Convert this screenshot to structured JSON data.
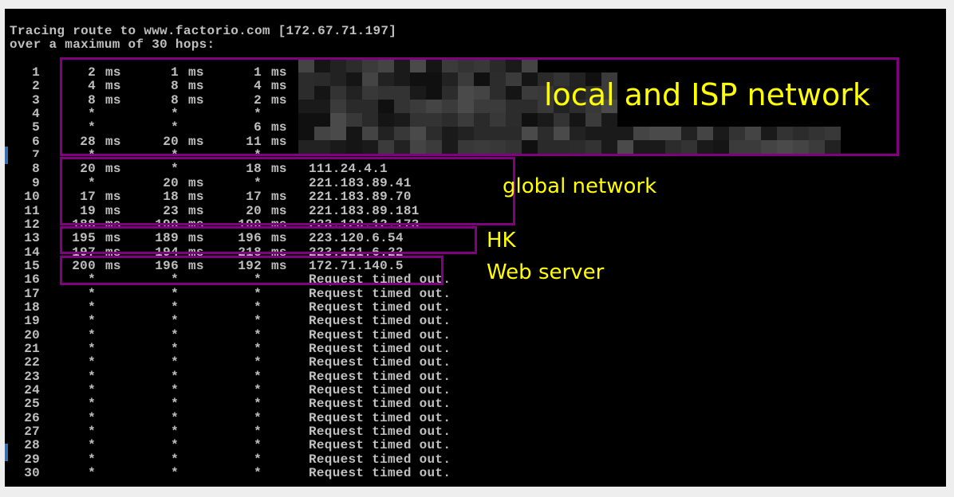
{
  "terminal": {
    "header_line_1": "Tracing route to www.factorio.com [172.67.71.197]",
    "header_line_2": "over a maximum of 30 hops:",
    "rows": [
      {
        "hop": "1",
        "r1": "2",
        "u1": "ms",
        "r2": "1",
        "u2": "ms",
        "r3": "1",
        "u3": "ms",
        "host": ""
      },
      {
        "hop": "2",
        "r1": "4",
        "u1": "ms",
        "r2": "8",
        "u2": "ms",
        "r3": "4",
        "u3": "ms",
        "host": ""
      },
      {
        "hop": "3",
        "r1": "8",
        "u1": "ms",
        "r2": "8",
        "u2": "ms",
        "r3": "2",
        "u3": "ms",
        "host": ""
      },
      {
        "hop": "4",
        "r1": "*",
        "u1": "",
        "r2": "*",
        "u2": "",
        "r3": "*",
        "u3": "",
        "host": ""
      },
      {
        "hop": "5",
        "r1": "*",
        "u1": "",
        "r2": "*",
        "u2": "",
        "r3": "6",
        "u3": "ms",
        "host": ""
      },
      {
        "hop": "6",
        "r1": "28",
        "u1": "ms",
        "r2": "20",
        "u2": "ms",
        "r3": "11",
        "u3": "ms",
        "host": ""
      },
      {
        "hop": "7",
        "r1": "*",
        "u1": "",
        "r2": "*",
        "u2": "",
        "r3": "*",
        "u3": "",
        "host": ""
      },
      {
        "hop": "8",
        "r1": "20",
        "u1": "ms",
        "r2": "*",
        "u2": "",
        "r3": "18",
        "u3": "ms",
        "host": "111.24.4.1"
      },
      {
        "hop": "9",
        "r1": "*",
        "u1": "",
        "r2": "20",
        "u2": "ms",
        "r3": "*",
        "u3": "",
        "host": "221.183.89.41"
      },
      {
        "hop": "10",
        "r1": "17",
        "u1": "ms",
        "r2": "18",
        "u2": "ms",
        "r3": "17",
        "u3": "ms",
        "host": "221.183.89.70"
      },
      {
        "hop": "11",
        "r1": "19",
        "u1": "ms",
        "r2": "23",
        "u2": "ms",
        "r3": "20",
        "u3": "ms",
        "host": "221.183.89.181"
      },
      {
        "hop": "12",
        "r1": "188",
        "u1": "ms",
        "r2": "190",
        "u2": "ms",
        "r3": "190",
        "u3": "ms",
        "host": "223.120.12.173"
      },
      {
        "hop": "13",
        "r1": "195",
        "u1": "ms",
        "r2": "189",
        "u2": "ms",
        "r3": "196",
        "u3": "ms",
        "host": "223.120.6.54"
      },
      {
        "hop": "14",
        "r1": "197",
        "u1": "ms",
        "r2": "194",
        "u2": "ms",
        "r3": "218",
        "u3": "ms",
        "host": "223.121.6.22"
      },
      {
        "hop": "15",
        "r1": "200",
        "u1": "ms",
        "r2": "196",
        "u2": "ms",
        "r3": "192",
        "u3": "ms",
        "host": "172.71.140.5"
      },
      {
        "hop": "16",
        "r1": "*",
        "u1": "",
        "r2": "*",
        "u2": "",
        "r3": "*",
        "u3": "",
        "host": "Request timed out."
      },
      {
        "hop": "17",
        "r1": "*",
        "u1": "",
        "r2": "*",
        "u2": "",
        "r3": "*",
        "u3": "",
        "host": "Request timed out."
      },
      {
        "hop": "18",
        "r1": "*",
        "u1": "",
        "r2": "*",
        "u2": "",
        "r3": "*",
        "u3": "",
        "host": "Request timed out."
      },
      {
        "hop": "19",
        "r1": "*",
        "u1": "",
        "r2": "*",
        "u2": "",
        "r3": "*",
        "u3": "",
        "host": "Request timed out."
      },
      {
        "hop": "20",
        "r1": "*",
        "u1": "",
        "r2": "*",
        "u2": "",
        "r3": "*",
        "u3": "",
        "host": "Request timed out."
      },
      {
        "hop": "21",
        "r1": "*",
        "u1": "",
        "r2": "*",
        "u2": "",
        "r3": "*",
        "u3": "",
        "host": "Request timed out."
      },
      {
        "hop": "22",
        "r1": "*",
        "u1": "",
        "r2": "*",
        "u2": "",
        "r3": "*",
        "u3": "",
        "host": "Request timed out."
      },
      {
        "hop": "23",
        "r1": "*",
        "u1": "",
        "r2": "*",
        "u2": "",
        "r3": "*",
        "u3": "",
        "host": "Request timed out."
      },
      {
        "hop": "24",
        "r1": "*",
        "u1": "",
        "r2": "*",
        "u2": "",
        "r3": "*",
        "u3": "",
        "host": "Request timed out."
      },
      {
        "hop": "25",
        "r1": "*",
        "u1": "",
        "r2": "*",
        "u2": "",
        "r3": "*",
        "u3": "",
        "host": "Request timed out."
      },
      {
        "hop": "26",
        "r1": "*",
        "u1": "",
        "r2": "*",
        "u2": "",
        "r3": "*",
        "u3": "",
        "host": "Request timed out."
      },
      {
        "hop": "27",
        "r1": "*",
        "u1": "",
        "r2": "*",
        "u2": "",
        "r3": "*",
        "u3": "",
        "host": "Request timed out."
      },
      {
        "hop": "28",
        "r1": "*",
        "u1": "",
        "r2": "*",
        "u2": "",
        "r3": "*",
        "u3": "",
        "host": "Request timed out."
      },
      {
        "hop": "29",
        "r1": "*",
        "u1": "",
        "r2": "*",
        "u2": "",
        "r3": "*",
        "u3": "",
        "host": "Request timed out."
      },
      {
        "hop": "30",
        "r1": "*",
        "u1": "",
        "r2": "*",
        "u2": "",
        "r3": "*",
        "u3": "",
        "host": "Request timed out."
      }
    ]
  },
  "annotations": {
    "local_isp": "local and ISP network",
    "global": "global network",
    "hk": "HK",
    "web_server": "Web server"
  },
  "colors": {
    "terminal_bg": "#000000",
    "terminal_text": "#c0c0c0",
    "annotation_box": "#800080",
    "annotation_text": "#ffff00"
  }
}
